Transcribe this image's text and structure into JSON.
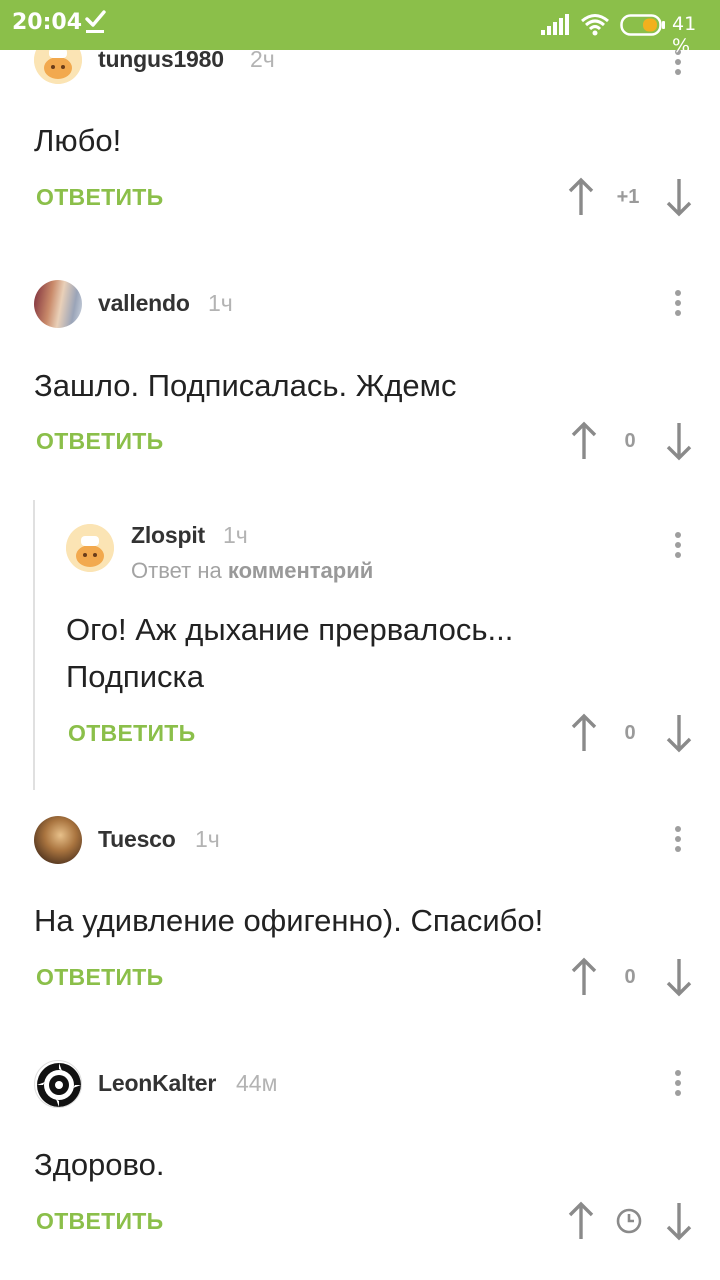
{
  "status_bar": {
    "time": "20:04",
    "battery_percent": "41 %",
    "colors": {
      "background": "#8bbf4a"
    }
  },
  "reply_label": "ОТВЕТИТЬ",
  "comments": [
    {
      "author": "tungus1980",
      "age": "2ч",
      "text": "Любо!",
      "score": "+1",
      "avatar_icon": "chef-avatar-icon"
    },
    {
      "author": "vallendo",
      "age": "1ч",
      "text": "Зашло. Подписалась. Ждемс",
      "score": "0",
      "avatar_icon": "photo-avatar"
    },
    {
      "author": "Zlospit",
      "age": "1ч",
      "reply_to_prefix": "Ответ на",
      "reply_to_target": "комментарий",
      "text_line1": "Ого! Аж дыхание прервалось...",
      "text_line2": "Подписка",
      "score": "0",
      "avatar_icon": "chef-avatar-icon"
    },
    {
      "author": "Tuesco",
      "age": "1ч",
      "text": "На удивление офигенно). Спасибо!",
      "score": "0",
      "avatar_icon": "photo-avatar"
    },
    {
      "author": "LeonKalter",
      "age": "44м",
      "text": "Здорово.",
      "score_icon": "clock-icon",
      "avatar_icon": "spiral-avatar"
    }
  ],
  "colors": {
    "accent": "#8bbf4a",
    "muted": "#9a9a9a"
  }
}
